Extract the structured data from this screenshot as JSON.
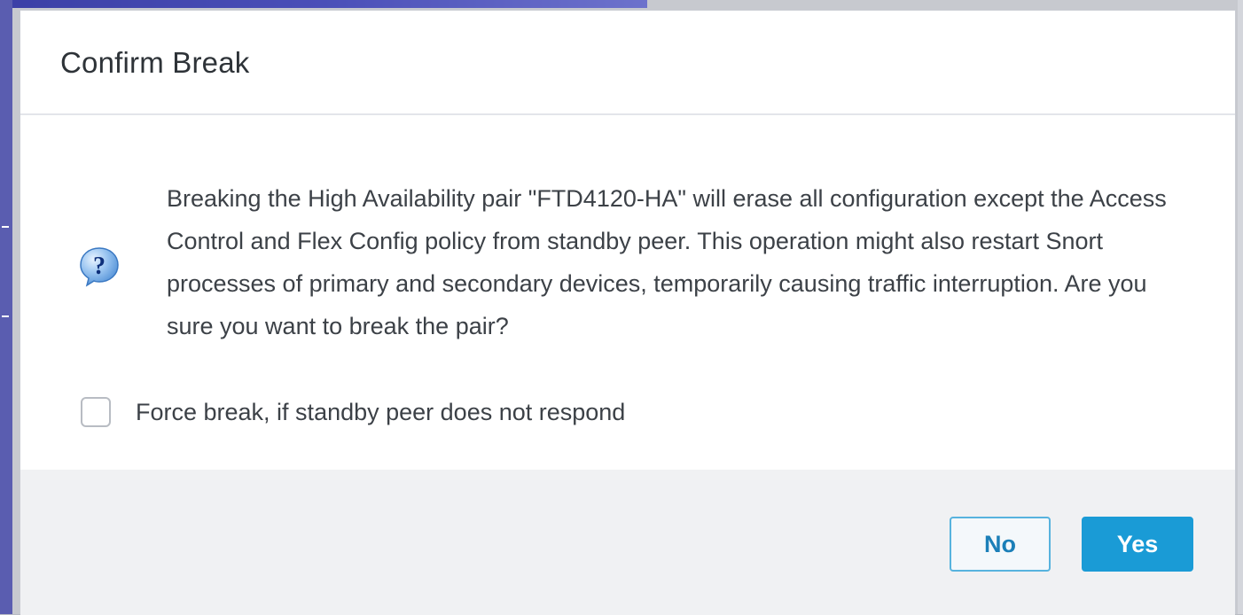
{
  "dialog": {
    "title": "Confirm Break",
    "message": "Breaking the High Availability pair \"FTD4120-HA\" will erase all configuration except the Access Control and Flex Config policy from standby peer. This operation might also restart Snort processes of primary and secondary devices, temporarily causing traffic interruption. Are you sure you want to break the pair?",
    "force_break": {
      "label": "Force break, if standby peer does not respond",
      "checked": false
    },
    "buttons": {
      "no_label": "No",
      "yes_label": "Yes"
    },
    "icon": "question-icon"
  },
  "colors": {
    "primary_button": "#1a9bd6",
    "secondary_button_border": "#57b3de",
    "footer_background": "#f0f1f3",
    "icon_blue": "#1d6fcf"
  }
}
